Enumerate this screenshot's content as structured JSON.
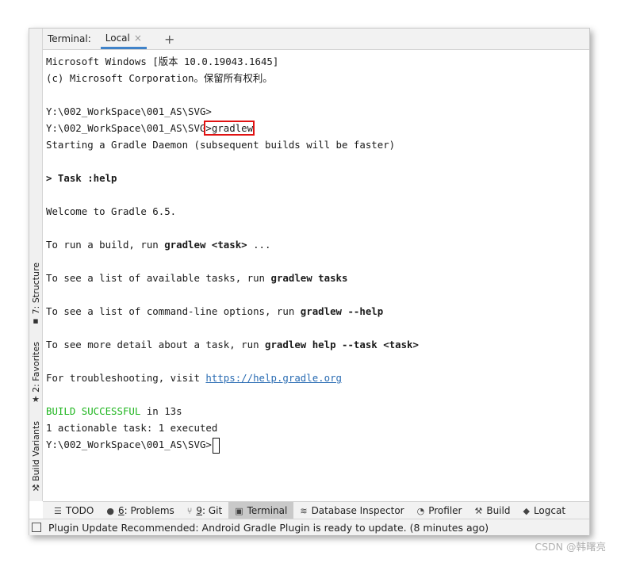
{
  "header": {
    "title": "Terminal:",
    "tab_local": "Local",
    "tab_close": "×",
    "add_tab": "+"
  },
  "left_strip": {
    "structure": "7: Structure",
    "favorites": "2: Favorites",
    "build_variants": "Build Variants"
  },
  "terminal": {
    "line1": "Microsoft Windows [版本 10.0.19043.1645]",
    "line2": "(c) Microsoft Corporation。保留所有权利。",
    "prompt1": "Y:\\002_WorkSpace\\001_AS\\SVG>",
    "prompt2_prefix": "Y:\\002_WorkSpace\\001_AS\\SVG",
    "prompt2_cmd": ">gradlew",
    "daemon": "Starting a Gradle Daemon (subsequent builds will be faster)",
    "task": "> Task :help",
    "welcome": "Welcome to Gradle 6.5.",
    "run_build_a": "To run a build, run ",
    "run_build_b": "gradlew <task>",
    "run_build_c": " ...",
    "list_tasks_a": "To see a list of available tasks, run ",
    "list_tasks_b": "gradlew tasks",
    "list_opts_a": "To see a list of command-line options, run ",
    "list_opts_b": "gradlew --help",
    "detail_a": "To see more detail about a task, run ",
    "detail_b": "gradlew help --task <task>",
    "trouble_a": "For troubleshooting, visit ",
    "trouble_link": "https://help.gradle.org",
    "build_success": "BUILD SUCCESSFUL",
    "build_time": " in 13s",
    "actionable": "1 actionable task: 1 executed",
    "prompt3": "Y:\\002_WorkSpace\\001_AS\\SVG>"
  },
  "toolbar": {
    "todo": "TODO",
    "problems_key": "6",
    "problems": ": Problems",
    "git_key": "9",
    "git": ": Git",
    "terminal": "Terminal",
    "database": "Database Inspector",
    "profiler": "Profiler",
    "build": "Build",
    "logcat": "Logcat"
  },
  "status": {
    "message": "Plugin Update Recommended: Android Gradle Plugin is ready to update. (8 minutes ago)"
  },
  "watermark": "CSDN @韩曙亮",
  "colors": {
    "success": "#1eb51e",
    "link": "#2a6cb3",
    "highlight_box": "#e01212",
    "tab_underline": "#4083c9"
  }
}
